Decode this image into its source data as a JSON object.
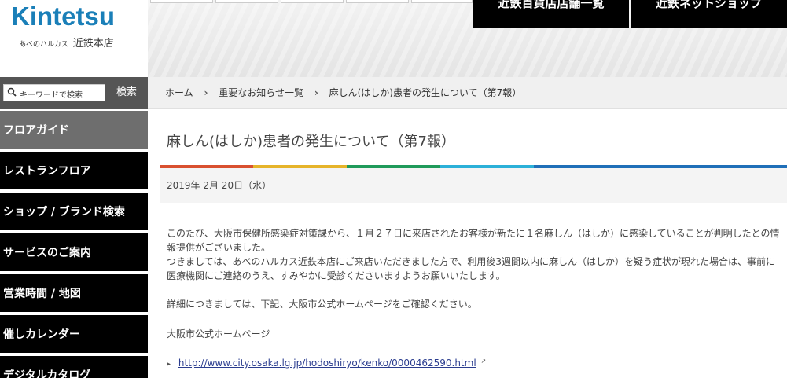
{
  "logo": {
    "brand": "Kintetsu",
    "sub_small": "あべのハルカス",
    "sub_main": "近鉄本店"
  },
  "search": {
    "placeholder": "キーワードで検索",
    "button_label": "検索"
  },
  "nav": [
    {
      "label": "フロアガイド",
      "active": true
    },
    {
      "label": "レストランフロア",
      "active": false
    },
    {
      "label": "ショップ / ブランド検索",
      "active": false
    },
    {
      "label": "サービスのご案内",
      "active": false
    },
    {
      "label": "営業時間 / 地図",
      "active": false
    },
    {
      "label": "催しカレンダー",
      "active": false
    },
    {
      "label": "デジタルカタログ",
      "active": false
    }
  ],
  "header": {
    "store_list_label": "近鉄百貨店店舗一覧",
    "net_shop_label": "近鉄ネットショップ"
  },
  "breadcrumb": {
    "home": "ホーム",
    "notices": "重要なお知らせ一覧",
    "current": "麻しん(はしか)患者の発生について（第7報）"
  },
  "article": {
    "title": "麻しん(はしか)患者の発生について（第7報）",
    "date": "2019年 2月 20日（水）",
    "para1_line1": "このたび、大阪市保健所感染症対策課から、１月２７日に来店されたお客様が新たに１名麻しん（はしか）に感染していることが判明したとの情",
    "para1_line2": "報提供がございました。",
    "para1_line3": "つきましては、あべのハルカス近鉄本店にご来店いただきました方で、利用後3週間以内に麻しん（はしか）を疑う症状が現れた場合は、事前に",
    "para1_line4": "医療機関にご連絡のうえ、すみやかに受診くださいますようお願いいたします。",
    "para2": "詳細につきましては、下記、大阪市公式ホームページをご確認ください。",
    "para3": "大阪市公式ホームページ",
    "link": "http://www.city.osaka.lg.jp/hodoshiryo/kenko/0000462590.html"
  },
  "colors": {
    "brand_blue": "#1a7fb8",
    "bar_red": "#d9502f",
    "bar_yellow": "#e6b42a",
    "bar_green": "#1f9a5a",
    "bar_cyan": "#2bb0d8",
    "bar_blue": "#1f6fb8",
    "link": "#2b3d8f"
  }
}
